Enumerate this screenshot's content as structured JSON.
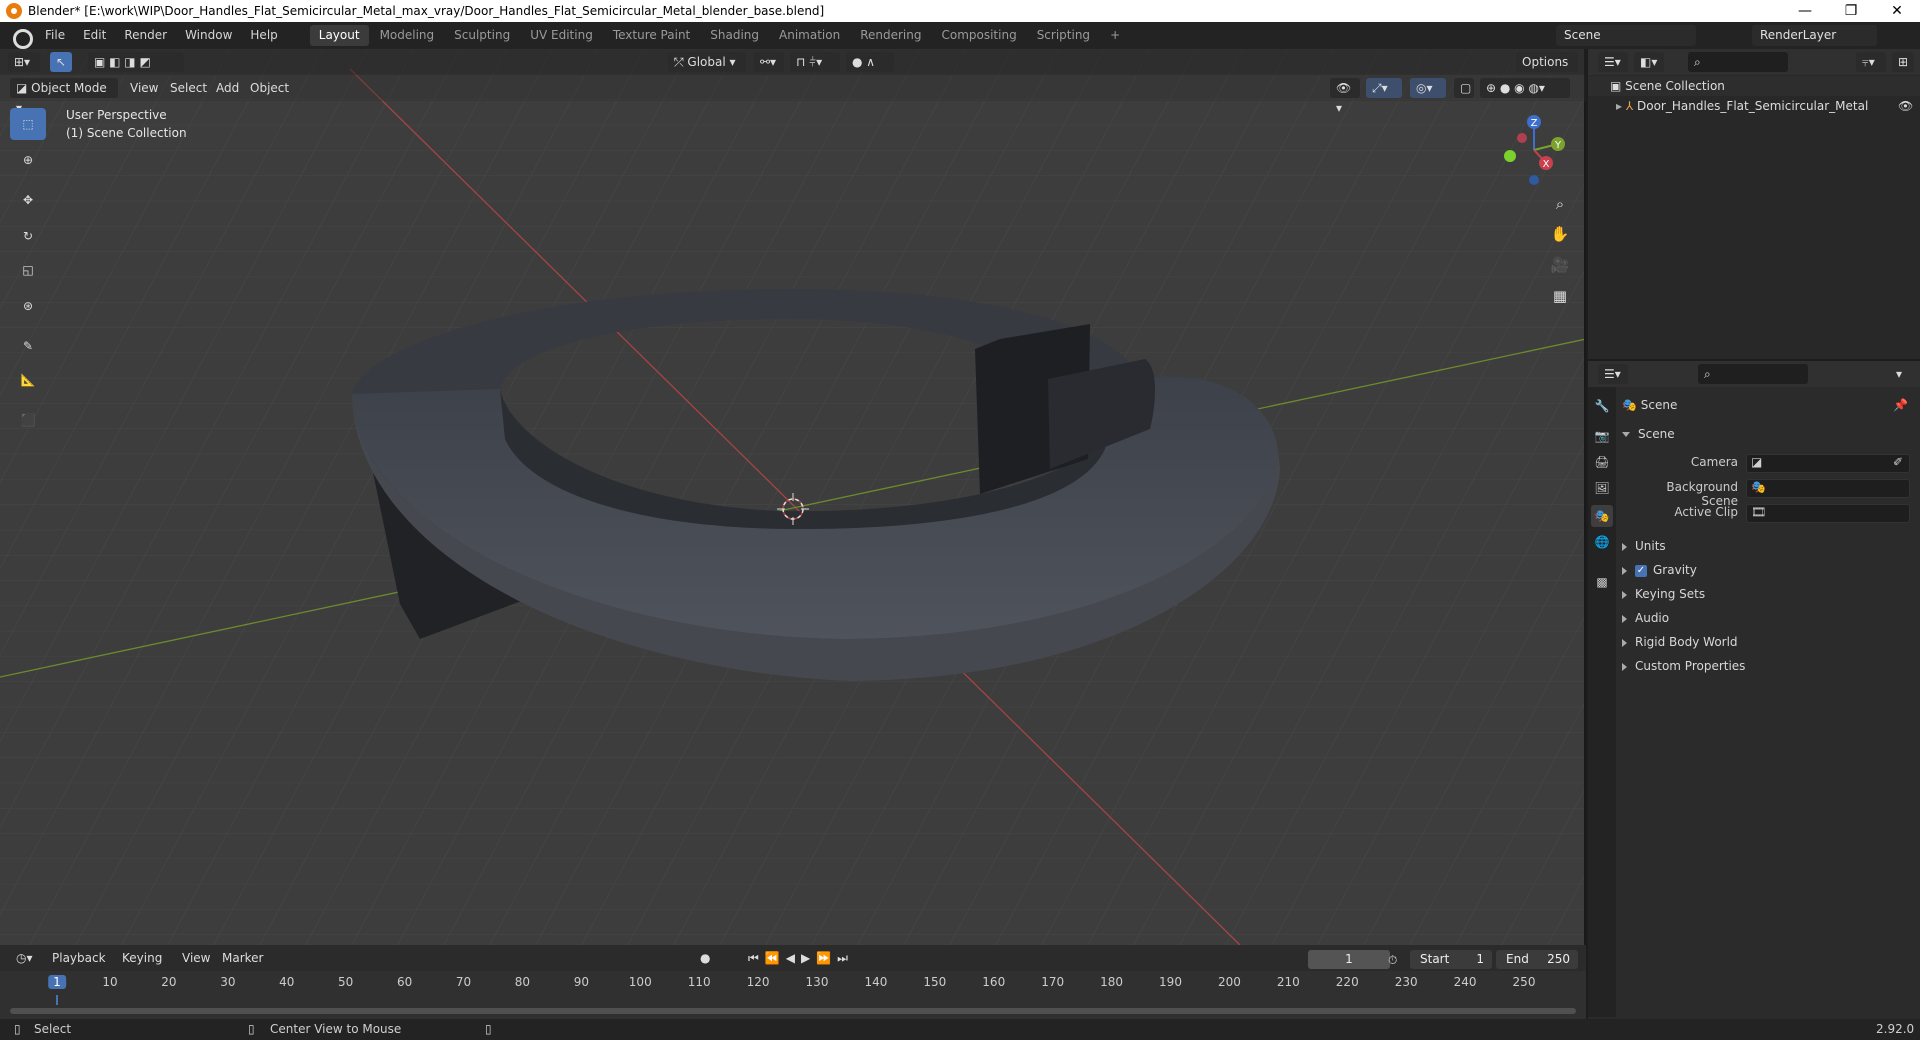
{
  "window": {
    "title": "Blender* [E:\\work\\WIP\\Door_Handles_Flat_Semicircular_Metal_max_vray/Door_Handles_Flat_Semicircular_Metal_blender_base.blend]",
    "minimize": "—",
    "maximize": "❐",
    "close": "✕"
  },
  "menu": [
    "File",
    "Edit",
    "Render",
    "Window",
    "Help"
  ],
  "workspaces": [
    "Layout",
    "Modeling",
    "Sculpting",
    "UV Editing",
    "Texture Paint",
    "Shading",
    "Animation",
    "Rendering",
    "Compositing",
    "Scripting"
  ],
  "active_workspace": "Layout",
  "add_workspace": "+",
  "scene_selector": "Scene",
  "view_layer": "RenderLayer",
  "viewport": {
    "mode": "Object Mode",
    "menus": [
      "View",
      "Select",
      "Add",
      "Object"
    ],
    "transform_orientation": "Global",
    "options": "Options",
    "overlay_line1": "User Perspective",
    "overlay_line2": "(1) Scene Collection",
    "gizmo": {
      "z": "Z",
      "y": "Y",
      "x": "X"
    }
  },
  "outliner": {
    "root": "Scene Collection",
    "items": [
      "Door_Handles_Flat_Semicircular_Metal"
    ]
  },
  "properties": {
    "context": "Scene",
    "panel": "Scene",
    "camera_label": "Camera",
    "background_label": "Background Scene",
    "clip_label": "Active Clip",
    "subpanels": [
      "Units",
      "Gravity",
      "Keying Sets",
      "Audio",
      "Rigid Body World",
      "Custom Properties"
    ]
  },
  "timeline": {
    "menus": [
      "Playback",
      "Keying",
      "View",
      "Marker"
    ],
    "current_frame": "1",
    "start_label": "Start",
    "start": "1",
    "end_label": "End",
    "end": "250",
    "ticks": [
      "1",
      "10",
      "20",
      "30",
      "40",
      "50",
      "60",
      "70",
      "80",
      "90",
      "100",
      "110",
      "120",
      "130",
      "140",
      "150",
      "160",
      "170",
      "180",
      "190",
      "200",
      "210",
      "220",
      "230",
      "240",
      "250"
    ]
  },
  "status": {
    "left": "Select",
    "middle": "Center View to Mouse",
    "version": "2.92.0"
  }
}
